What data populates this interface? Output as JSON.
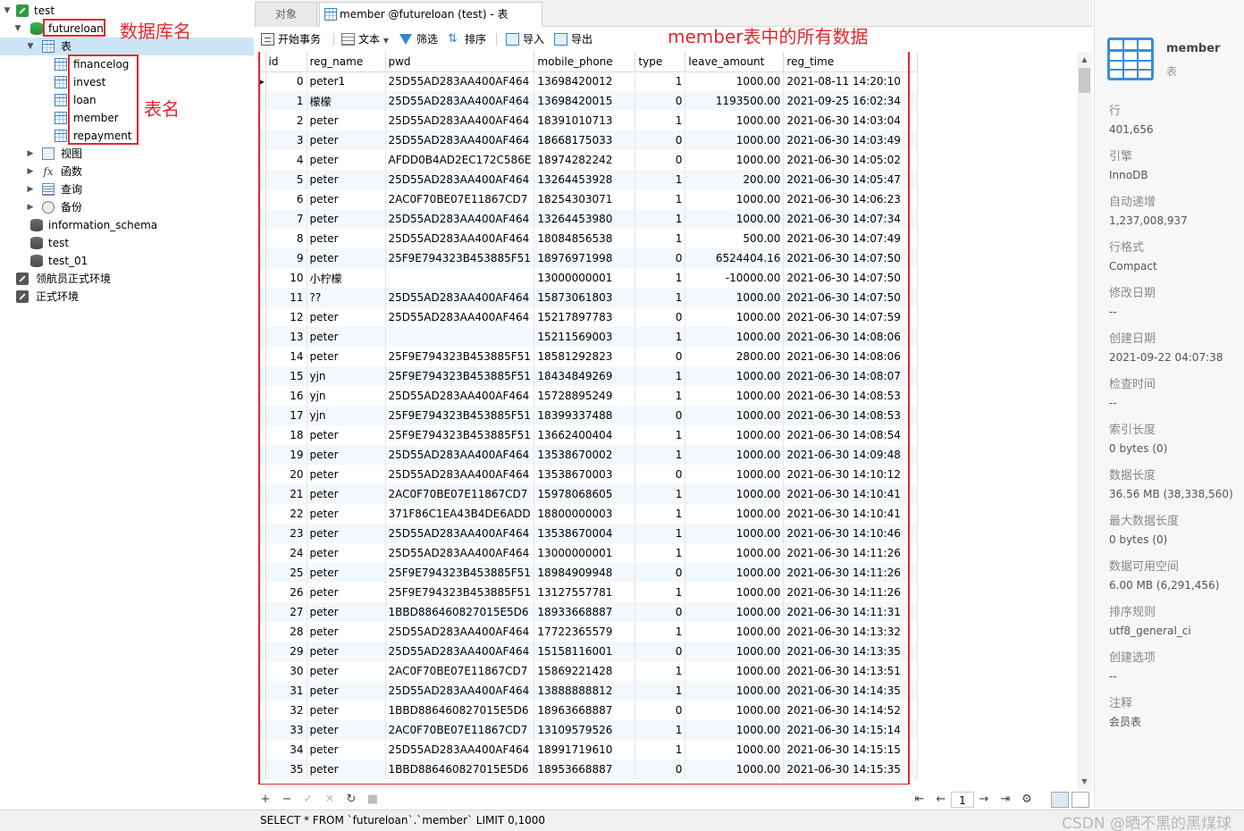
{
  "tree": {
    "connection": "test",
    "database": "futureloan",
    "tables_folder": "表",
    "tables": [
      "financelog",
      "invest",
      "loan",
      "member",
      "repayment"
    ],
    "folders": [
      "视图",
      "函数",
      "查询",
      "备份"
    ],
    "other_dbs": [
      "information_schema",
      "test",
      "test_01"
    ],
    "other_connections": [
      "领航员正式环境",
      "正式环境"
    ]
  },
  "annotations": {
    "db_label": "数据库名",
    "table_label": "表名",
    "data_label": "member表中的所有数据"
  },
  "tabs": {
    "objects": "对象",
    "active": "member @futureloan (test) - 表"
  },
  "toolbar": {
    "begin": "开始事务",
    "text": "文本",
    "filter": "筛选",
    "sort": "排序",
    "import": "导入",
    "export": "导出"
  },
  "grid": {
    "columns": [
      "id",
      "reg_name",
      "pwd",
      "mobile_phone",
      "type",
      "leave_amount",
      "reg_time"
    ],
    "rows": [
      [
        "0",
        "peter1",
        "25D55AD283AA400AF464",
        "13698420012",
        "1",
        "1000.00",
        "2021-08-11 14:20:10"
      ],
      [
        "1",
        "檬檬",
        "25D55AD283AA400AF464",
        "13698420015",
        "0",
        "1193500.00",
        "2021-09-25 16:02:34"
      ],
      [
        "2",
        "peter",
        "25D55AD283AA400AF464",
        "18391010713",
        "1",
        "1000.00",
        "2021-06-30 14:03:04"
      ],
      [
        "3",
        "peter",
        "25D55AD283AA400AF464",
        "18668175033",
        "0",
        "1000.00",
        "2021-06-30 14:03:49"
      ],
      [
        "4",
        "peter",
        "AFDD0B4AD2EC172C586E",
        "18974282242",
        "0",
        "1000.00",
        "2021-06-30 14:05:02"
      ],
      [
        "5",
        "peter",
        "25D55AD283AA400AF464",
        "13264453928",
        "1",
        "200.00",
        "2021-06-30 14:05:47"
      ],
      [
        "6",
        "peter",
        "2AC0F70BE07E11867CD7",
        "18254303071",
        "1",
        "1000.00",
        "2021-06-30 14:06:23"
      ],
      [
        "7",
        "peter",
        "25D55AD283AA400AF464",
        "13264453980",
        "1",
        "1000.00",
        "2021-06-30 14:07:34"
      ],
      [
        "8",
        "peter",
        "25D55AD283AA400AF464",
        "18084856538",
        "1",
        "500.00",
        "2021-06-30 14:07:49"
      ],
      [
        "9",
        "peter",
        "25F9E794323B453885F51",
        "18976971998",
        "0",
        "6524404.16",
        "2021-06-30 14:07:50"
      ],
      [
        "10",
        "小柠檬",
        "",
        "13000000001",
        "1",
        "-10000.00",
        "2021-06-30 14:07:50"
      ],
      [
        "11",
        "??",
        "25D55AD283AA400AF464",
        "15873061803",
        "1",
        "1000.00",
        "2021-06-30 14:07:50"
      ],
      [
        "12",
        "peter",
        "25D55AD283AA400AF464",
        "15217897783",
        "0",
        "1000.00",
        "2021-06-30 14:07:59"
      ],
      [
        "13",
        "peter",
        "",
        "15211569003",
        "1",
        "1000.00",
        "2021-06-30 14:08:06"
      ],
      [
        "14",
        "peter",
        "25F9E794323B453885F51",
        "18581292823",
        "0",
        "2800.00",
        "2021-06-30 14:08:06"
      ],
      [
        "15",
        "yjn",
        "25F9E794323B453885F51",
        "18434849269",
        "1",
        "1000.00",
        "2021-06-30 14:08:07"
      ],
      [
        "16",
        "yjn",
        "25D55AD283AA400AF464",
        "15728895249",
        "1",
        "1000.00",
        "2021-06-30 14:08:53"
      ],
      [
        "17",
        "yjn",
        "25F9E794323B453885F51",
        "18399337488",
        "0",
        "1000.00",
        "2021-06-30 14:08:53"
      ],
      [
        "18",
        "peter",
        "25F9E794323B453885F51",
        "13662400404",
        "1",
        "1000.00",
        "2021-06-30 14:08:54"
      ],
      [
        "19",
        "peter",
        "25D55AD283AA400AF464",
        "13538670002",
        "1",
        "1000.00",
        "2021-06-30 14:09:48"
      ],
      [
        "20",
        "peter",
        "25D55AD283AA400AF464",
        "13538670003",
        "0",
        "1000.00",
        "2021-06-30 14:10:12"
      ],
      [
        "21",
        "peter",
        "2AC0F70BE07E11867CD7",
        "15978068605",
        "1",
        "1000.00",
        "2021-06-30 14:10:41"
      ],
      [
        "22",
        "peter",
        "371F86C1EA43B4DE6ADD",
        "18800000003",
        "1",
        "1000.00",
        "2021-06-30 14:10:41"
      ],
      [
        "23",
        "peter",
        "25D55AD283AA400AF464",
        "13538670004",
        "1",
        "1000.00",
        "2021-06-30 14:10:46"
      ],
      [
        "24",
        "peter",
        "25D55AD283AA400AF464",
        "13000000001",
        "1",
        "1000.00",
        "2021-06-30 14:11:26"
      ],
      [
        "25",
        "peter",
        "25F9E794323B453885F51",
        "18984909948",
        "0",
        "1000.00",
        "2021-06-30 14:11:26"
      ],
      [
        "26",
        "peter",
        "25F9E794323B453885F51",
        "13127557781",
        "1",
        "1000.00",
        "2021-06-30 14:11:26"
      ],
      [
        "27",
        "peter",
        "1BBD886460827015E5D6",
        "18933668887",
        "0",
        "1000.00",
        "2021-06-30 14:11:31"
      ],
      [
        "28",
        "peter",
        "25D55AD283AA400AF464",
        "17722365579",
        "1",
        "1000.00",
        "2021-06-30 14:13:32"
      ],
      [
        "29",
        "peter",
        "25D55AD283AA400AF464",
        "15158116001",
        "0",
        "1000.00",
        "2021-06-30 14:13:35"
      ],
      [
        "30",
        "peter",
        "2AC0F70BE07E11867CD7",
        "15869221428",
        "1",
        "1000.00",
        "2021-06-30 14:13:51"
      ],
      [
        "31",
        "peter",
        "25D55AD283AA400AF464",
        "13888888812",
        "1",
        "1000.00",
        "2021-06-30 14:14:35"
      ],
      [
        "32",
        "peter",
        "1BBD886460827015E5D6",
        "18963668887",
        "0",
        "1000.00",
        "2021-06-30 14:14:52"
      ],
      [
        "33",
        "peter",
        "2AC0F70BE07E11867CD7",
        "13109579526",
        "1",
        "1000.00",
        "2021-06-30 14:15:14"
      ],
      [
        "34",
        "peter",
        "25D55AD283AA400AF464",
        "18991719610",
        "1",
        "1000.00",
        "2021-06-30 14:15:15"
      ],
      [
        "35",
        "peter",
        "1BBD886460827015E5D6",
        "18953668887",
        "0",
        "1000.00",
        "2021-06-30 14:15:35"
      ]
    ]
  },
  "nav": {
    "page": "1"
  },
  "status": {
    "sql": "SELECT * FROM `futureloan`.`member` LIMIT 0,1000",
    "watermark": "CSDN @晒不黑的黑煤球"
  },
  "info": {
    "table_name": "member",
    "table_type": "表",
    "props": [
      {
        "k": "行",
        "v": "401,656"
      },
      {
        "k": "引擎",
        "v": "InnoDB"
      },
      {
        "k": "自动递增",
        "v": "1,237,008,937"
      },
      {
        "k": "行格式",
        "v": "Compact"
      },
      {
        "k": "修改日期",
        "v": "--"
      },
      {
        "k": "创建日期",
        "v": "2021-09-22 04:07:38"
      },
      {
        "k": "检查时间",
        "v": "--"
      },
      {
        "k": "索引长度",
        "v": "0 bytes (0)"
      },
      {
        "k": "数据长度",
        "v": "36.56 MB (38,338,560)"
      },
      {
        "k": "最大数据长度",
        "v": "0 bytes (0)"
      },
      {
        "k": "数据可用空间",
        "v": "6.00 MB (6,291,456)"
      },
      {
        "k": "排序规则",
        "v": "utf8_general_ci"
      },
      {
        "k": "创建选项",
        "v": "--"
      },
      {
        "k": "注释",
        "v": "会员表"
      }
    ]
  },
  "colors": {
    "annotation_red": "#e5262b",
    "selection": "#cde6f7",
    "accent_blue": "#3a8dd8"
  }
}
